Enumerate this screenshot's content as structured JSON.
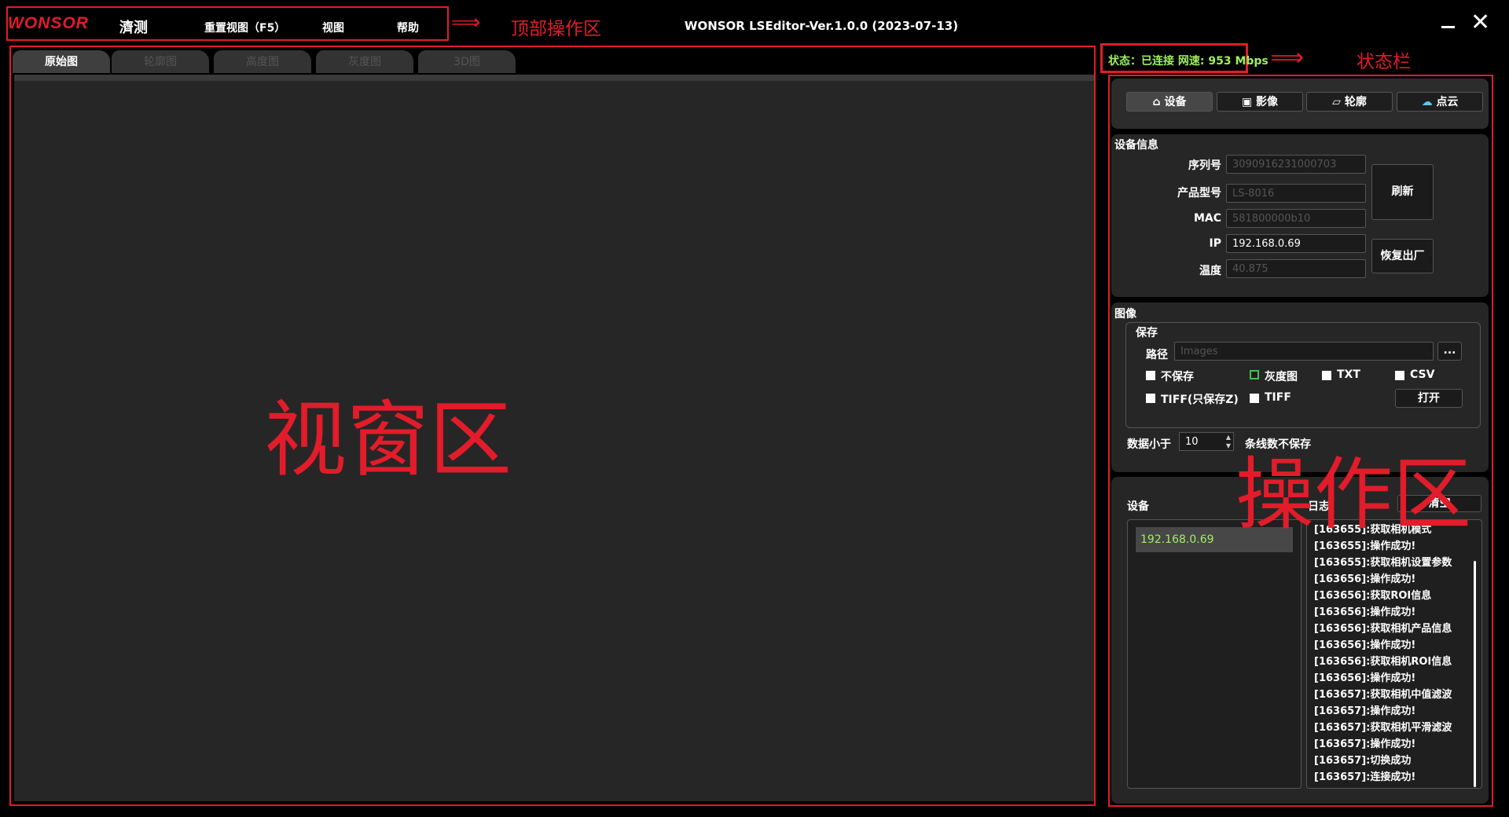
{
  "top_bar": {
    "logo": "WONSOR",
    "logo_cn": "濟测",
    "menus": [
      "重置视图（F5）",
      "视图",
      "帮助"
    ],
    "title": "WONSOR LSEditor-Ver.1.0.0 (2023-07-13)",
    "annotation": "顶部操作区"
  },
  "viewer": {
    "tabs": [
      "原始图",
      "轮廓图",
      "高度图",
      "灰度图",
      "3D图"
    ],
    "annotation": "视窗区"
  },
  "status": {
    "text": "状态：已连接 网速: 953 Mbps",
    "annotation": "状态栏"
  },
  "ops": {
    "annotation": "操作区",
    "nav": [
      {
        "icon": "home-icon",
        "label": "设备"
      },
      {
        "icon": "image-icon",
        "label": "影像"
      },
      {
        "icon": "contour-icon",
        "label": "轮廓"
      },
      {
        "icon": "cloud-icon",
        "label": "点云"
      }
    ],
    "device_info": {
      "title": "设备信息",
      "serial_label": "序列号",
      "serial": "3090916231000703",
      "model_label": "产品型号",
      "model": "LS-8016",
      "mac_label": "MAC",
      "mac": "581800000b10",
      "ip_label": "IP",
      "ip": "192.168.0.69",
      "temp_label": "温度",
      "temp": "40.875",
      "refresh": "刷新",
      "factory_reset": "恢复出厂"
    },
    "image": {
      "title": "图像",
      "save_group": "保存",
      "path_label": "路径",
      "path_placeholder": "Images",
      "browse": "...",
      "no_save": "不保存",
      "gray": "灰度图",
      "txt": "TXT",
      "csv": "CSV",
      "tiff_z": "TIFF(只保存Z)",
      "tiff": "TIFF",
      "open": "打开",
      "data_less_label": "数据小于",
      "data_less_value": "10",
      "data_less_suffix": "条线数不保存"
    },
    "bottom": {
      "device_label": "设备",
      "log_label": "日志",
      "clear": "清空",
      "devices": [
        "192.168.0.69"
      ],
      "logs": [
        "[163655]:获取相机模式",
        "[163655]:操作成功!",
        "[163655]:获取相机设置参数",
        "[163656]:操作成功!",
        "[163656]:获取ROI信息",
        "[163656]:操作成功!",
        "[163656]:获取相机产品信息",
        "[163656]:操作成功!",
        "[163656]:获取相机ROI信息",
        "[163656]:操作成功!",
        "[163657]:获取相机中值滤波",
        "[163657]:操作成功!",
        "[163657]:获取相机平滑滤波",
        "[163657]:操作成功!",
        "[163657]:切换成功",
        "[163657]:连接成功!"
      ]
    }
  }
}
